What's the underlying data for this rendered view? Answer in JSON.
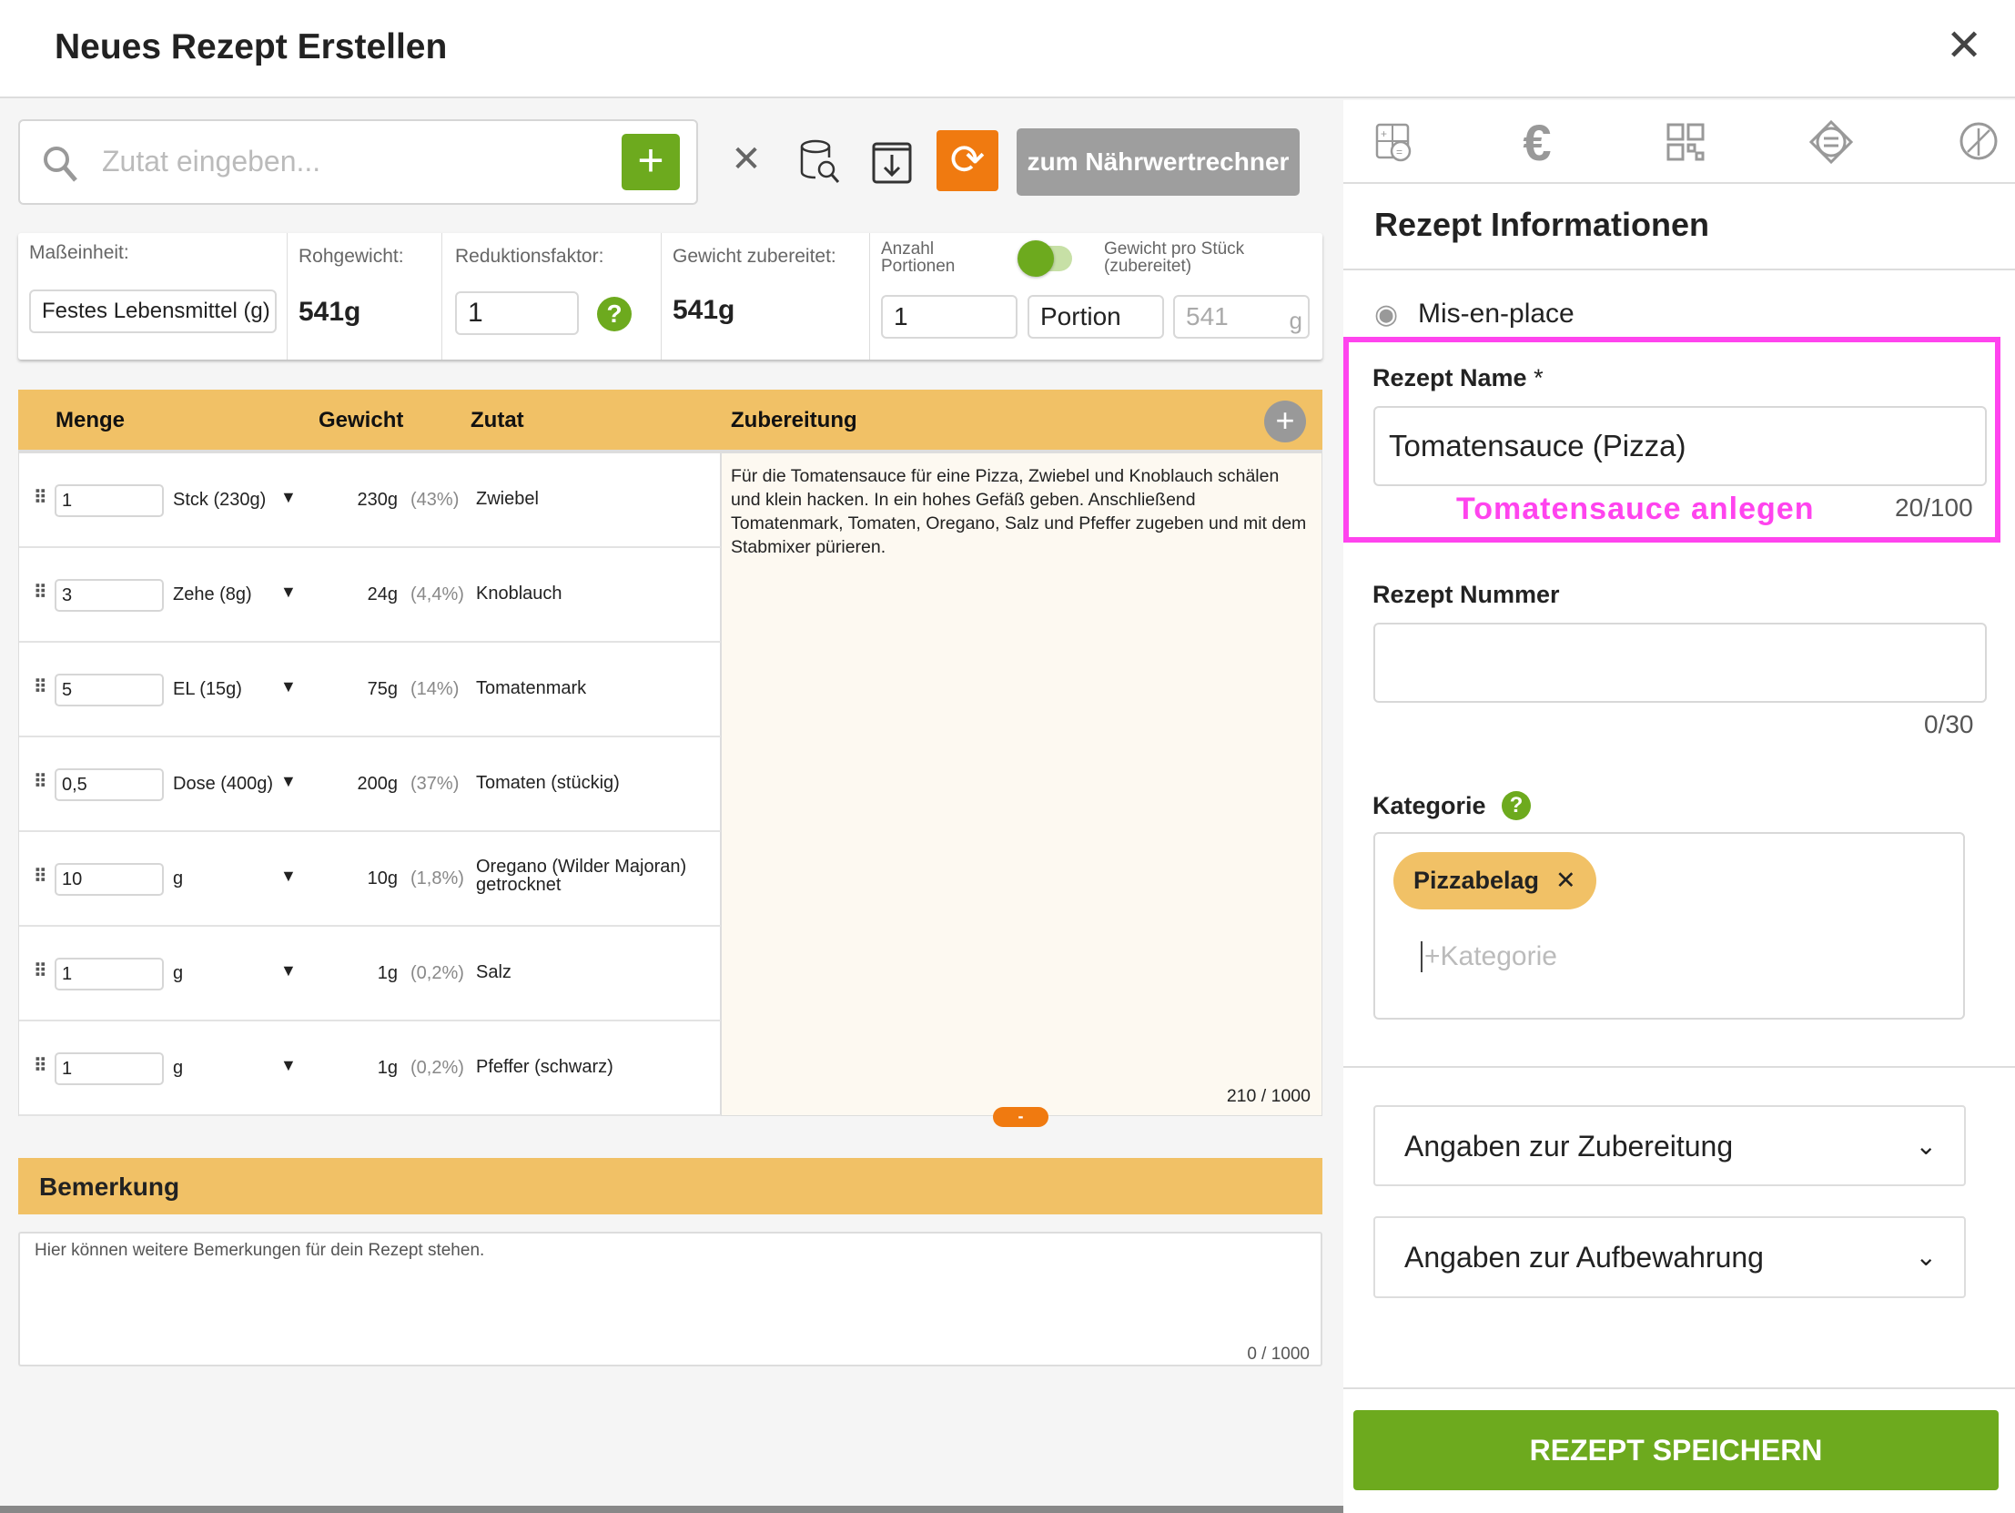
{
  "header": {
    "title": "Neues Rezept Erstellen",
    "close_icon": "close-icon"
  },
  "toolbar": {
    "search_placeholder": "Zutat eingeben...",
    "add": "+",
    "nutrition_button": "zum Nährwertrechner",
    "colors": {
      "green": "#6daa1e",
      "orange": "#f07a10"
    }
  },
  "info": {
    "unit_label": "Maßeinheit:",
    "unit_value": "Festes Lebensmittel (g)",
    "raw_label": "Rohgewicht:",
    "raw_value": "541g",
    "reduction_label": "Reduktionsfaktor:",
    "reduction_value": "1",
    "help": "?",
    "prepared_label": "Gewicht zubereitet:",
    "prepared_value": "541g",
    "portions_label": "Anzahl Portionen",
    "toggle_on": true,
    "piece_label": "Gewicht pro Stück (zubereitet)",
    "portions_value": "1",
    "portion_unit": "Portion",
    "piece_weight": "541",
    "piece_unit": "g"
  },
  "table": {
    "headers": {
      "qty": "Menge",
      "weight": "Gewicht",
      "ingredient": "Zutat",
      "prep": "Zubereitung"
    },
    "rows": [
      {
        "qty": "1",
        "unit": "Stck (230g)",
        "weight": "230g",
        "pct": "(43%)",
        "name": "Zwiebel"
      },
      {
        "qty": "3",
        "unit": "Zehe (8g)",
        "weight": "24g",
        "pct": "(4,4%)",
        "name": "Knoblauch"
      },
      {
        "qty": "5",
        "unit": "EL (15g)",
        "weight": "75g",
        "pct": "(14%)",
        "name": "Tomatenmark"
      },
      {
        "qty": "0,5",
        "unit": "Dose (400g)",
        "weight": "200g",
        "pct": "(37%)",
        "name": "Tomaten (stückig)"
      },
      {
        "qty": "10",
        "unit": "g",
        "weight": "10g",
        "pct": "(1,8%)",
        "name": "Oregano (Wilder Majoran) getrocknet"
      },
      {
        "qty": "1",
        "unit": "g",
        "weight": "1g",
        "pct": "(0,2%)",
        "name": "Salz"
      },
      {
        "qty": "1",
        "unit": "g",
        "weight": "1g",
        "pct": "(0,2%)",
        "name": "Pfeffer (schwarz)"
      }
    ],
    "prep_text": "Für die Tomatensauce für eine Pizza, Zwiebel und Knoblauch schälen und klein hacken. In ein hohes Gefäß geben. Anschließend Tomatenmark, Tomaten, Oregano, Salz und Pfeffer zugeben und mit dem Stabmixer pürieren.",
    "prep_count": "210 / 1000",
    "collapse": "-"
  },
  "remark": {
    "title": "Bemerkung",
    "placeholder": "Hier können weitere Bemerkungen für dein Rezept stehen.",
    "count": "0 / 1000"
  },
  "sidebar": {
    "tabs": [
      "calculator-icon",
      "euro-icon",
      "qr-code-icon",
      "allergen-icon",
      "gluten-free-icon"
    ],
    "section_title": "Rezept Informationen",
    "misenplace": "Mis-en-place",
    "name_label": "Rezept Name",
    "required": "*",
    "name_value": "Tomatensauce (Pizza)",
    "annotation": "Tomatensauce anlegen",
    "name_count": "20/100",
    "number_label": "Rezept Nummer",
    "number_value": "",
    "number_count": "0/30",
    "category_label": "Kategorie",
    "category_help": "?",
    "category_chip": "Pizzabelag",
    "category_placeholder": "+Kategorie",
    "accordion1": "Angaben zur Zubereitung",
    "accordion2": "Angaben zur Aufbewahrung",
    "save": "REZEPT SPEICHERN",
    "highlight_color": "#ff44ee"
  }
}
